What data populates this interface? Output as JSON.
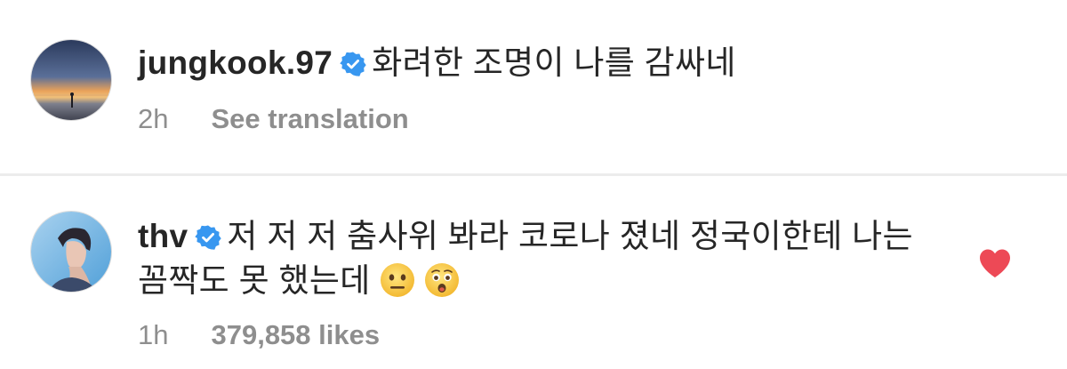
{
  "comments": [
    {
      "username": "jungkook.97",
      "verified": true,
      "text": "화려한 조명이 나를 감싸네",
      "time": "2h",
      "action": "See translation",
      "avatar_icon": "sunset-silhouette-avatar"
    },
    {
      "username": "thv",
      "verified": true,
      "text": "저 저 저 춤사위 봐라 코로나 졌네 정국이한테 나는 꼼짝도 못 했는데",
      "emojis": [
        "neutral-face-emoji",
        "hushed-face-emoji"
      ],
      "time": "1h",
      "likes": "379,858 likes",
      "liked": true,
      "avatar_icon": "profile-portrait-avatar"
    }
  ],
  "colors": {
    "text": "#262626",
    "meta": "#8e8e8e",
    "verified": "#3897f0",
    "like": "#ed4956",
    "divider": "#ececec"
  }
}
